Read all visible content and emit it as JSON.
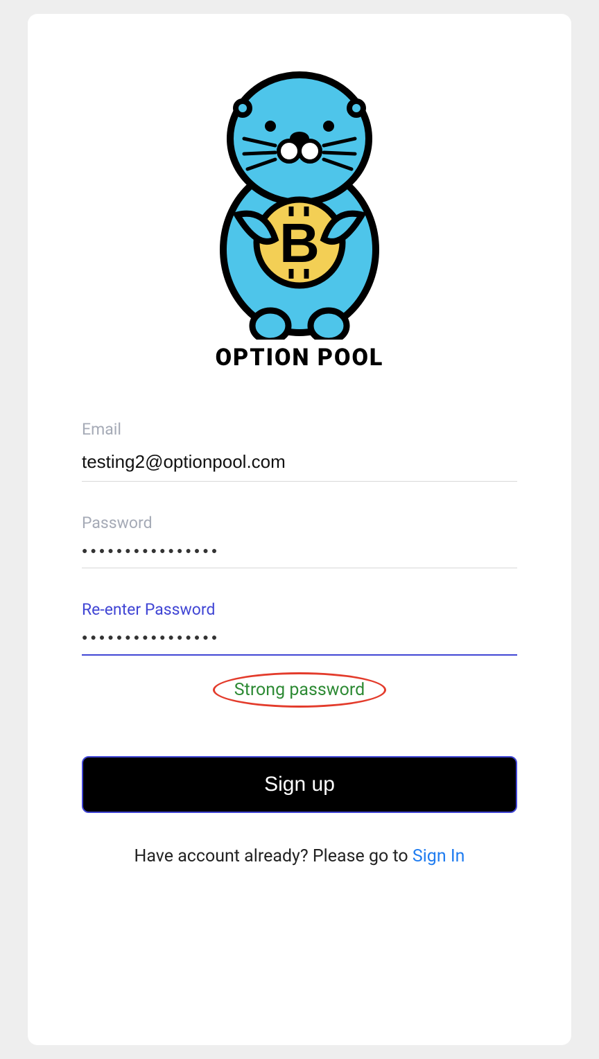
{
  "brand": {
    "name": "OPTION POOL"
  },
  "form": {
    "email": {
      "label": "Email",
      "value": "testing2@optionpool.com"
    },
    "password": {
      "label": "Password",
      "masked": "●●●●●●●●●●●●●●●●"
    },
    "confirm": {
      "label": "Re-enter Password",
      "masked": "●●●●●●●●●●●●●●●●"
    },
    "strength_text": "Strong password",
    "submit_label": "Sign up"
  },
  "footer": {
    "prompt": "Have account already? Please go to ",
    "link_text": "Sign In"
  }
}
